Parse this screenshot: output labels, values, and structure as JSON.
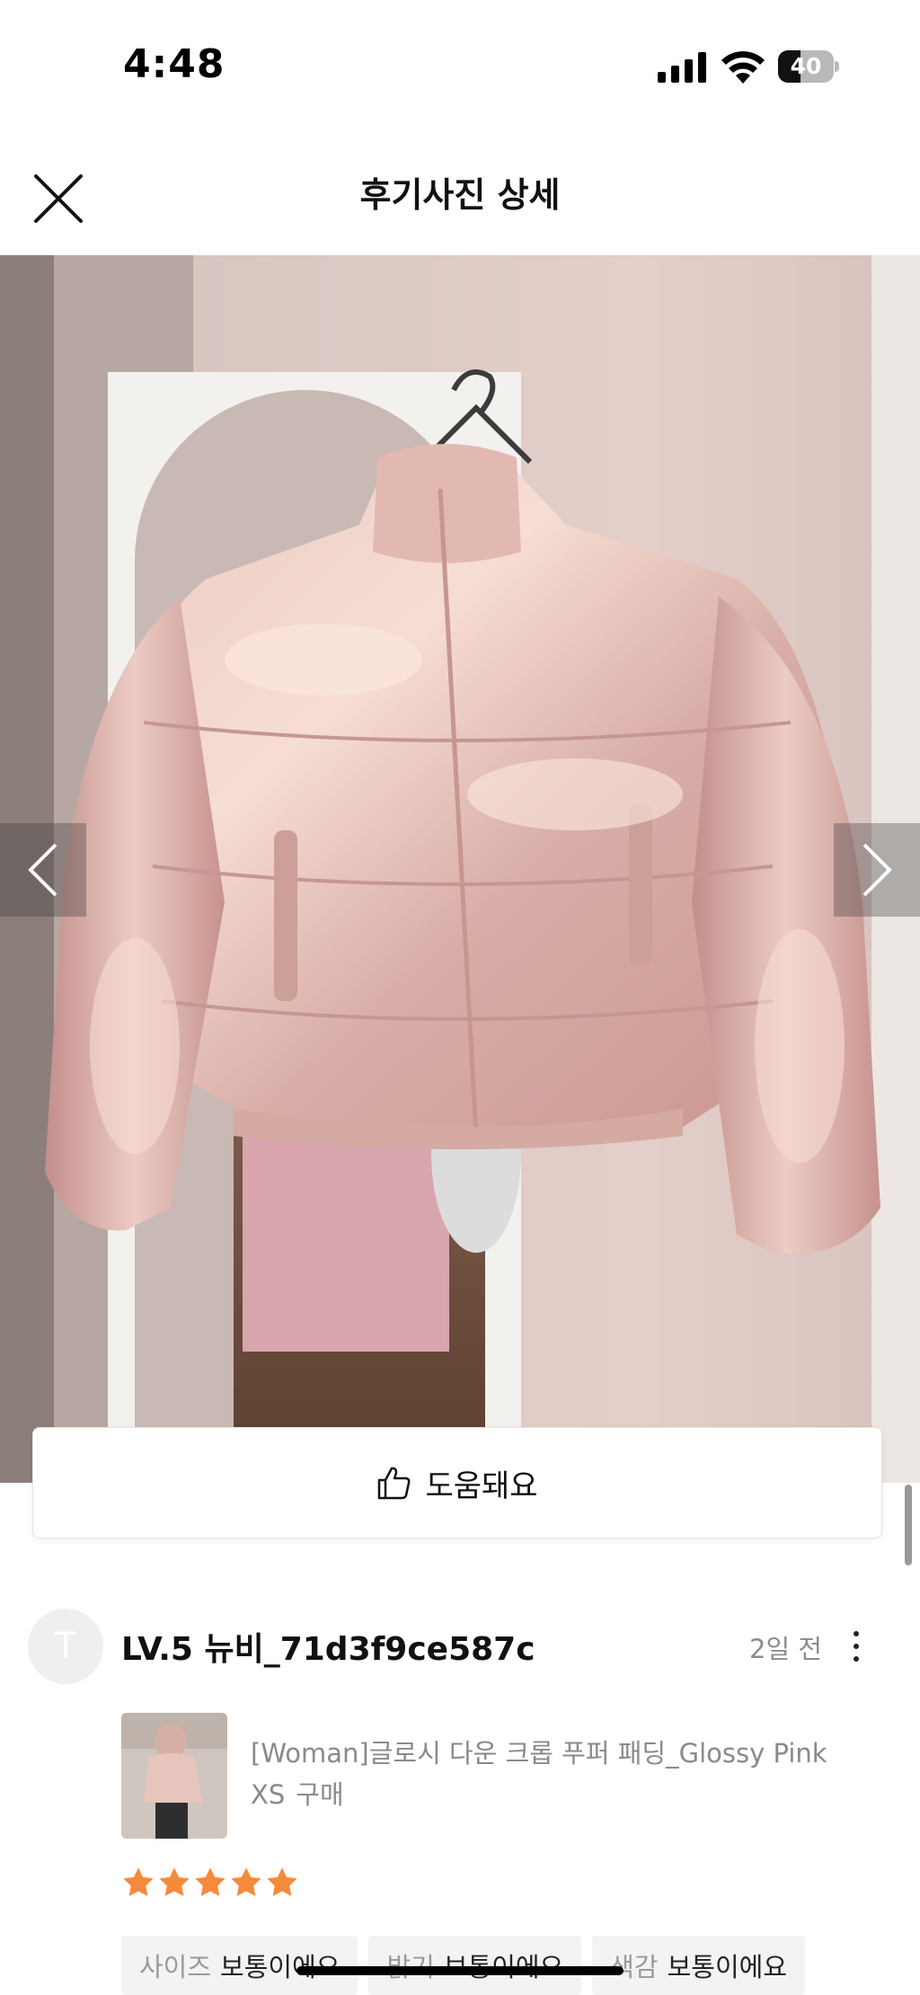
{
  "status_bar": {
    "time": "4:48",
    "battery_level": "40",
    "battery_fraction": 0.4,
    "icons": [
      "signal-icon",
      "wifi-icon",
      "battery-icon"
    ]
  },
  "header": {
    "title": "후기사진 상세",
    "close_icon": "close-icon"
  },
  "photo_viewer": {
    "image_description_icon": "review-photo",
    "prev_icon": "chevron-left-icon",
    "next_icon": "chevron-right-icon"
  },
  "helpful_button": {
    "label": "도움돼요",
    "icon": "thumbs-up-icon"
  },
  "review": {
    "avatar_letter": "T",
    "username": "LV.5 뉴비_71d3f9ce587c",
    "time": "2일 전",
    "product": {
      "name": "[Woman]글로시 다운 크롭 푸퍼 패딩_Glossy Pink",
      "option": "XS",
      "purchase": "구매"
    },
    "rating": 5,
    "rating_max": 5,
    "rating_color": "#F7893B",
    "attributes": [
      {
        "label": "사이즈",
        "value": "보통이에요"
      },
      {
        "label": "밝기",
        "value": "보통이에요"
      },
      {
        "label": "색감",
        "value": "보통이에요"
      }
    ]
  }
}
